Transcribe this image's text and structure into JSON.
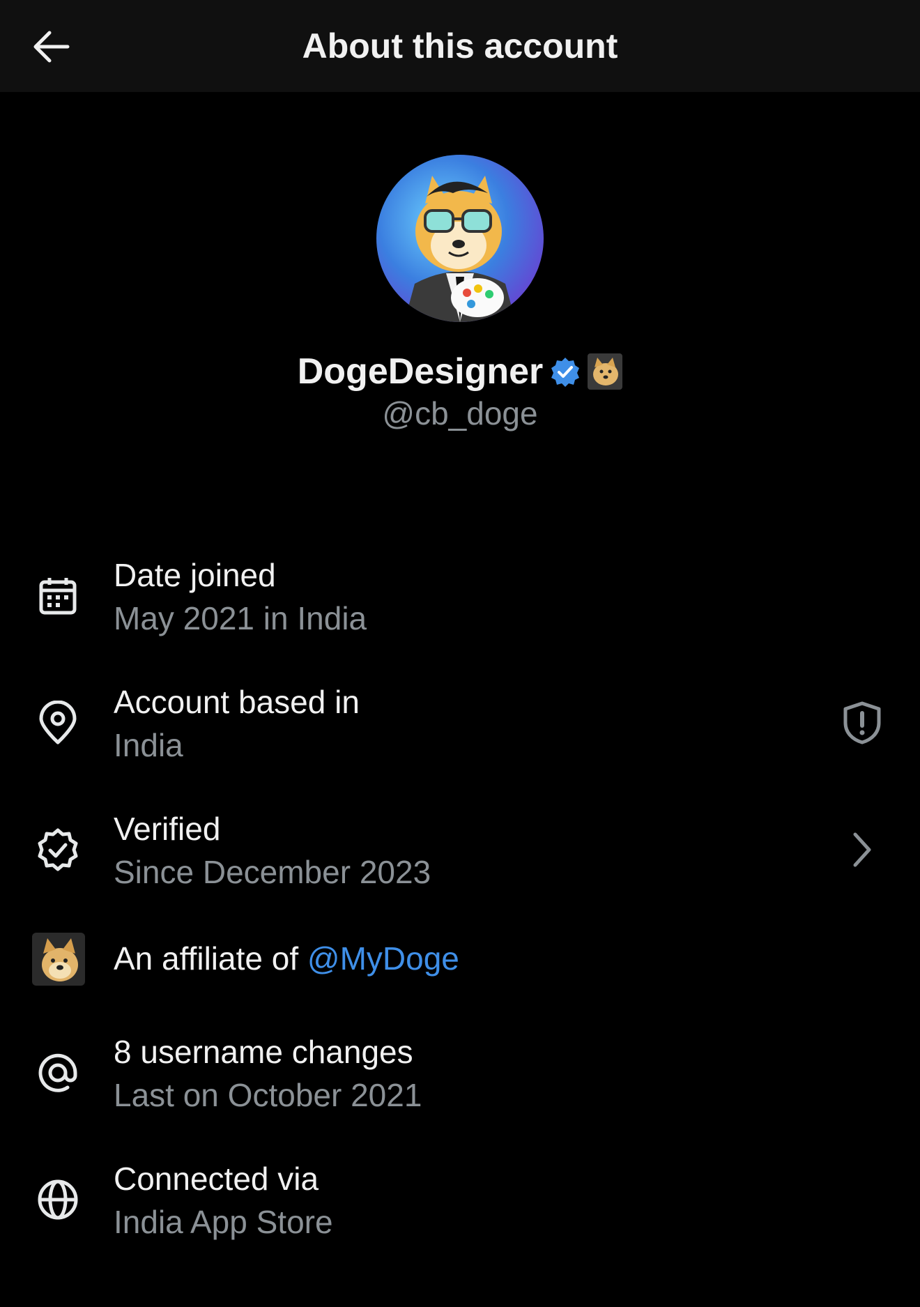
{
  "header": {
    "title": "About this account"
  },
  "profile": {
    "display_name": "DogeDesigner",
    "handle": "@cb_doge"
  },
  "rows": [
    {
      "title": "Date joined",
      "subtitle": "May 2021 in India"
    },
    {
      "title": "Account based in",
      "subtitle": "India"
    },
    {
      "title": "Verified",
      "subtitle": "Since December 2023"
    },
    {
      "title_prefix": "An affiliate of ",
      "link": "@MyDoge"
    },
    {
      "title": "8 username changes",
      "subtitle": "Last on October 2021"
    },
    {
      "title": "Connected via",
      "subtitle": "India App Store"
    }
  ],
  "colors": {
    "background": "#000000",
    "header": "#101010",
    "accent": "#3f8fe8",
    "muted": "#8b9196"
  },
  "icons": [
    "back-arrow-icon",
    "verified-badge-icon",
    "calendar-icon",
    "location-pin-icon",
    "shield-alert-icon",
    "verified-seal-icon",
    "chevron-right-icon",
    "at-sign-icon",
    "globe-icon"
  ]
}
